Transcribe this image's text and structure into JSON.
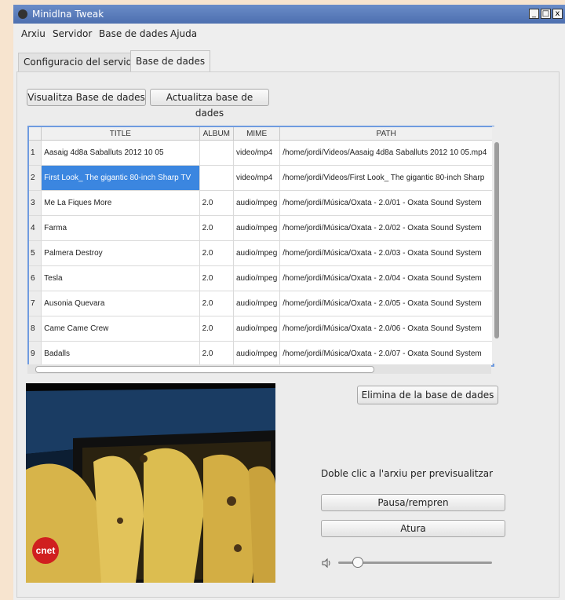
{
  "window": {
    "title": "Minidlna Tweak",
    "controls": {
      "minimize": "_",
      "maximize": "□",
      "close": "x"
    }
  },
  "menu": [
    "Arxiu",
    "Servidor",
    "Base de dades",
    "Ajuda"
  ],
  "tabs": [
    {
      "label": "Configuracio del servidor",
      "active": false
    },
    {
      "label": "Base de dades",
      "active": true
    }
  ],
  "toolbar": {
    "view_db": "Visualitza Base de dades",
    "update_db": "Actualitza base de dades"
  },
  "table": {
    "columns": [
      "",
      "TITLE",
      "ALBUM",
      "MIME",
      "PATH"
    ],
    "rows": [
      [
        "1",
        "Aasaig 4d8a Saballuts 2012 10 05",
        "",
        "video/mp4",
        "/home/jordi/Videos/Aasaig 4d8a Saballuts 2012 10 05.mp4"
      ],
      [
        "2",
        "First Look_ The gigantic 80-inch Sharp TV",
        "",
        "video/mp4",
        "/home/jordi/Videos/First Look_ The gigantic 80-inch Sharp"
      ],
      [
        "3",
        "Me La Fiques More",
        "2.0",
        "audio/mpeg",
        "/home/jordi/Música/Oxata - 2.0/01 - Oxata Sound System"
      ],
      [
        "4",
        "Farma",
        "2.0",
        "audio/mpeg",
        "/home/jordi/Música/Oxata - 2.0/02 - Oxata Sound System"
      ],
      [
        "5",
        "Palmera Destroy",
        "2.0",
        "audio/mpeg",
        "/home/jordi/Música/Oxata - 2.0/03 - Oxata Sound System"
      ],
      [
        "6",
        "Tesla",
        "2.0",
        "audio/mpeg",
        "/home/jordi/Música/Oxata - 2.0/04 - Oxata Sound System"
      ],
      [
        "7",
        "Ausonia Quevara",
        "2.0",
        "audio/mpeg",
        "/home/jordi/Música/Oxata - 2.0/05 - Oxata Sound System"
      ],
      [
        "8",
        "Came Came Crew",
        "2.0",
        "audio/mpeg",
        "/home/jordi/Música/Oxata - 2.0/06 - Oxata Sound System"
      ],
      [
        "9",
        "Badalls",
        "2.0",
        "audio/mpeg",
        "/home/jordi/Música/Oxata - 2.0/07 - Oxata Sound System"
      ]
    ],
    "selected_row": 1
  },
  "actions": {
    "delete": "Elimina de la base de dades",
    "hint": "Doble clic a l'arxiu per previsualitzar",
    "pause": "Pausa/rempren",
    "stop": "Atura"
  },
  "video": {
    "watermark": "cnet"
  },
  "volume": {
    "level": 0.12
  },
  "colors": {
    "selection": "#3b86e0",
    "table_border": "#6f9be0",
    "titlebar": "#5577b8"
  }
}
